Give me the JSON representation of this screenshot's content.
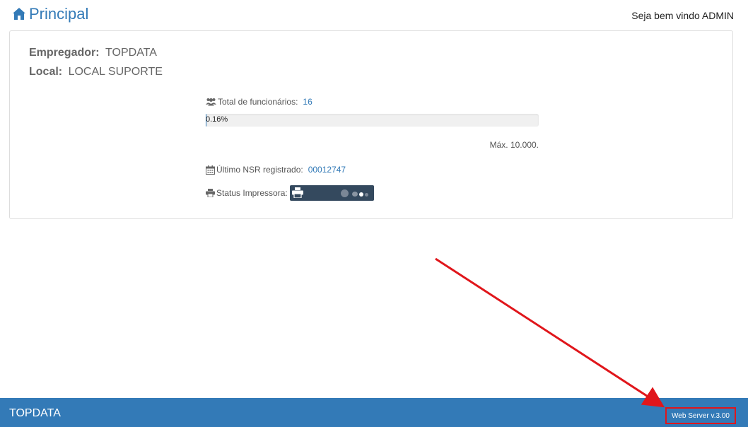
{
  "header": {
    "title": "Principal",
    "welcome": "Seja bem vindo ADMIN"
  },
  "employer": {
    "label": "Empregador:",
    "value": "TOPDATA"
  },
  "location": {
    "label": "Local:",
    "value": "LOCAL SUPORTE"
  },
  "stats": {
    "employees_label": "Total de funcionários:",
    "employees_value": "16",
    "progress_text": "0.16%",
    "progress_fraction": 0.0016,
    "max_text": "Máx. 10.000.",
    "nsr_label": "Último NSR registrado:",
    "nsr_value": "00012747",
    "printer_label": "Status Impressora:"
  },
  "footer": {
    "brand": "TOPDATA",
    "version": "Web Server v.3.00"
  },
  "colors": {
    "accent": "#337ab7",
    "annotation": "#e0161b",
    "printer_badge": "#34495e"
  },
  "icons": {
    "title": "home-icon",
    "employees": "users-icon",
    "nsr": "calendar-icon",
    "printer": "printer-icon"
  }
}
